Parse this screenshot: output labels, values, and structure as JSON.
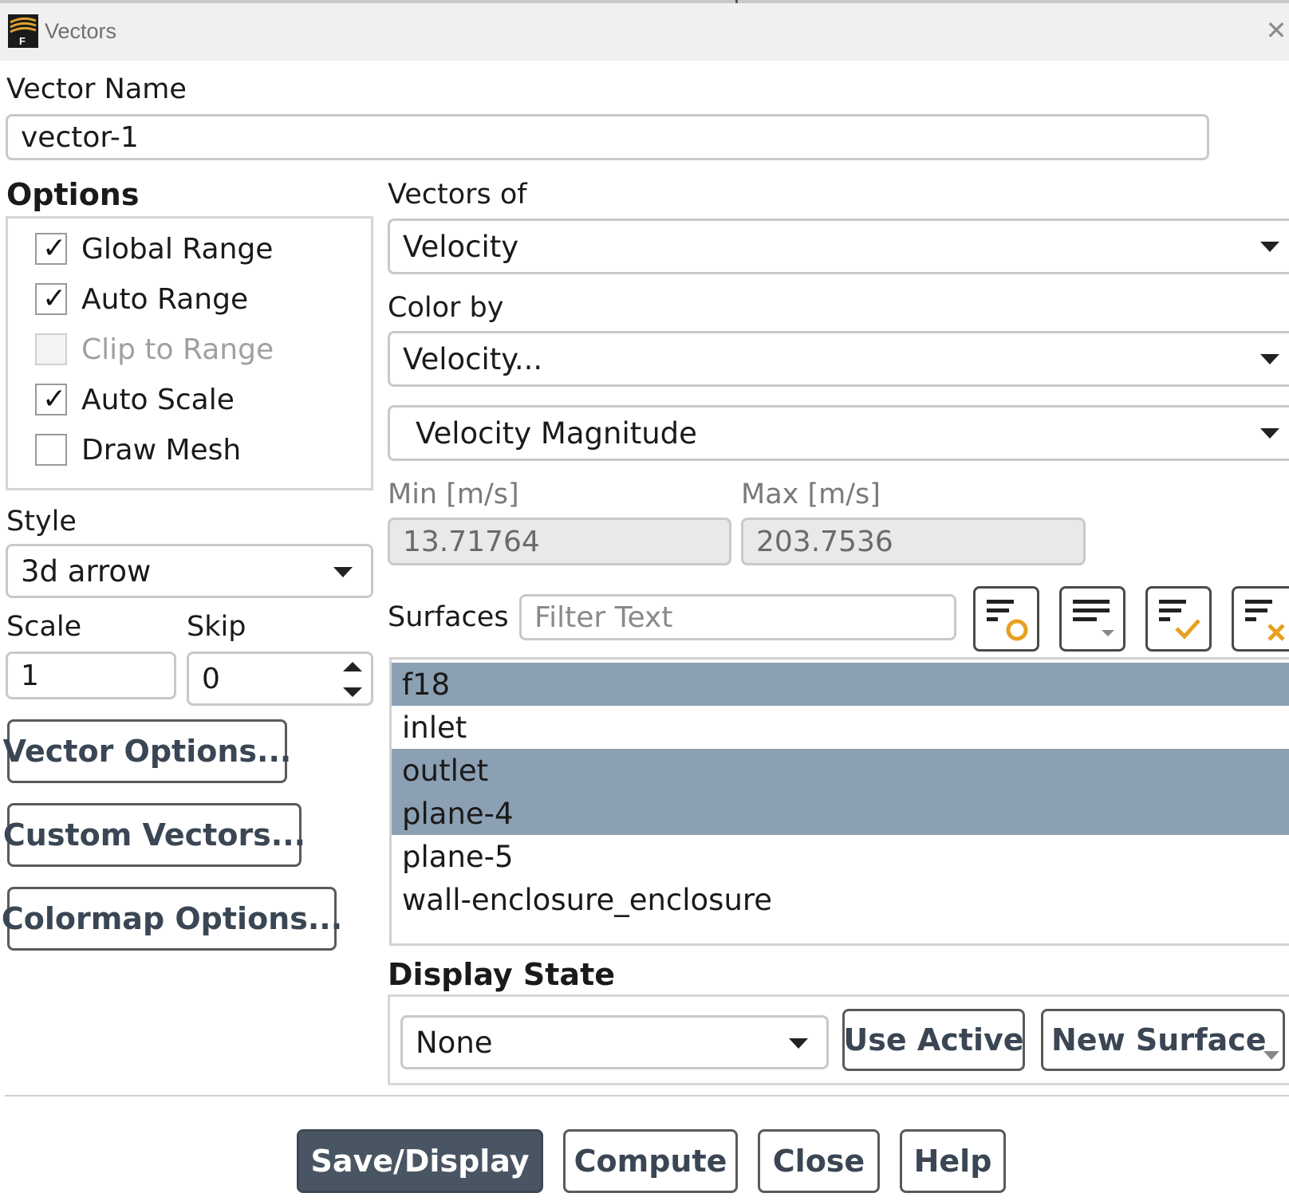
{
  "window": {
    "title": "Vectors"
  },
  "vector_name": {
    "label": "Vector Name",
    "value": "vector-1"
  },
  "options": {
    "heading": "Options",
    "items": [
      {
        "label": "Global Range",
        "checked": true,
        "enabled": true
      },
      {
        "label": "Auto Range",
        "checked": true,
        "enabled": true
      },
      {
        "label": "Clip to Range",
        "checked": false,
        "enabled": false
      },
      {
        "label": "Auto Scale",
        "checked": true,
        "enabled": true
      },
      {
        "label": "Draw Mesh",
        "checked": false,
        "enabled": true
      }
    ]
  },
  "style": {
    "label": "Style",
    "value": "3d arrow"
  },
  "scale": {
    "label": "Scale",
    "value": "1"
  },
  "skip": {
    "label": "Skip",
    "value": "0"
  },
  "left_buttons": {
    "vector_options": "Vector Options...",
    "custom_vectors": "Custom Vectors...",
    "colormap_options": "Colormap Options..."
  },
  "vectors_of": {
    "label": "Vectors of",
    "value": "Velocity"
  },
  "color_by": {
    "label": "Color by",
    "value": "Velocity...",
    "sub_value": "Velocity Magnitude"
  },
  "range": {
    "min_label": "Min [m/s]",
    "min_value": "13.71764",
    "max_label": "Max [m/s]",
    "max_value": "203.7536"
  },
  "surfaces": {
    "label": "Surfaces",
    "filter_placeholder": "Filter Text",
    "icons": [
      "filter-new-icon",
      "select-dropdown-icon",
      "select-all-icon",
      "deselect-all-icon"
    ],
    "items": [
      {
        "name": "f18",
        "selected": true
      },
      {
        "name": "inlet",
        "selected": false
      },
      {
        "name": "outlet",
        "selected": true
      },
      {
        "name": "plane-4",
        "selected": true
      },
      {
        "name": "plane-5",
        "selected": false
      },
      {
        "name": "wall-enclosure_enclosure",
        "selected": false
      }
    ]
  },
  "display_state": {
    "heading": "Display State",
    "value": "None",
    "use_active": "Use Active",
    "new_surface": "New Surface"
  },
  "footer": {
    "save_display": "Save/Display",
    "compute": "Compute",
    "close": "Close",
    "help": "Help"
  },
  "colors": {
    "selection": "#8ca0b4",
    "primary_button": "#4a5563",
    "button_text": "#3a4654"
  }
}
